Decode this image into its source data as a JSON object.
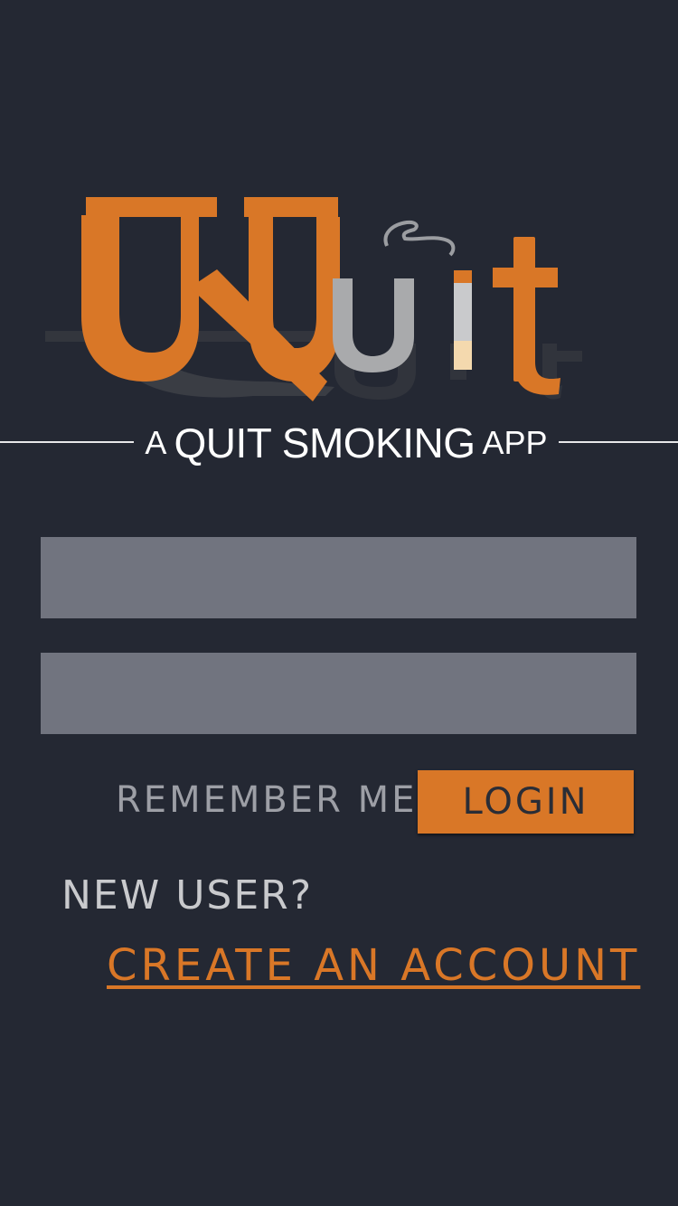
{
  "logo": {
    "letters": [
      "Q",
      "u",
      "i",
      "t"
    ],
    "brand_color": "#d97727",
    "icon": "cigarette-icon"
  },
  "tagline": {
    "prefix": "A",
    "main": "QUIT SMOKING",
    "suffix": "APP"
  },
  "form": {
    "username_value": "",
    "password_value": ""
  },
  "actions": {
    "remember_label": "REMEMBER ME",
    "login_label": "LOGIN",
    "new_user_label": "NEW USER?",
    "create_account_label": "CREATE AN ACCOUNT"
  },
  "colors": {
    "background": "#242833",
    "accent": "#d97727",
    "field": "#71747f"
  }
}
